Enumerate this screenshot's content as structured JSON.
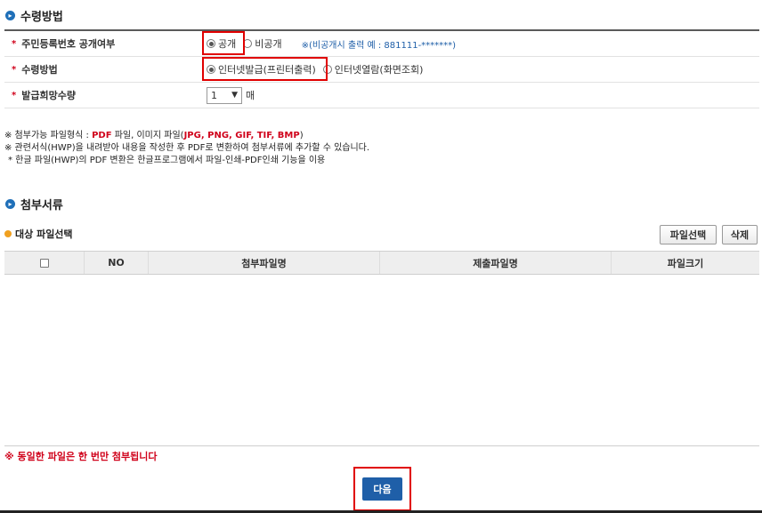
{
  "section_receive": {
    "title": "수령방법"
  },
  "form": {
    "row1": {
      "label": "주민등록번호 공개여부",
      "options": [
        "공개",
        "비공개"
      ],
      "note": "※(비공개시 출력 예 : 881111-*******)"
    },
    "row2": {
      "label": "수령방법",
      "options": [
        "인터넷발급(프린터출력)",
        "인터넷열람(화면조회)"
      ]
    },
    "row3": {
      "label": "발급희망수량",
      "quantity": "1",
      "unit": "매"
    },
    "star": "*"
  },
  "notes": {
    "line1_prefix": "※ 첨부가능 파일형식 : ",
    "line1_pdf": "PDF",
    "line1_mid": " 파일, 이미지 파일(",
    "line1_img": "JPG, PNG, GIF, TIF, BMP",
    "line1_suffix": ")",
    "line2": "※ 관련서식(HWP)을 내려받아 내용을 작성한 후 PDF로 변환하여 첨부서류에 추가할 수 있습니다.",
    "line3": "* 한글 파일(HWP)의 PDF 변환은 한글프로그램에서 파일-인쇄-PDF인쇄 기능을 이용"
  },
  "section_attach": {
    "title": "첨부서류"
  },
  "file_section": {
    "title": "대상 파일선택",
    "select_button": "파일선택",
    "delete_button": "삭제",
    "columns": [
      "NO",
      "첨부파일명",
      "제출파일명",
      "파일크기"
    ]
  },
  "warning": "※ 동일한 파일은 한 번만 첨부됩니다",
  "next_button": "다음",
  "colors": {
    "accent_blue": "#1f5fa8",
    "red": "#d0021b",
    "highlight": "#e00000"
  }
}
